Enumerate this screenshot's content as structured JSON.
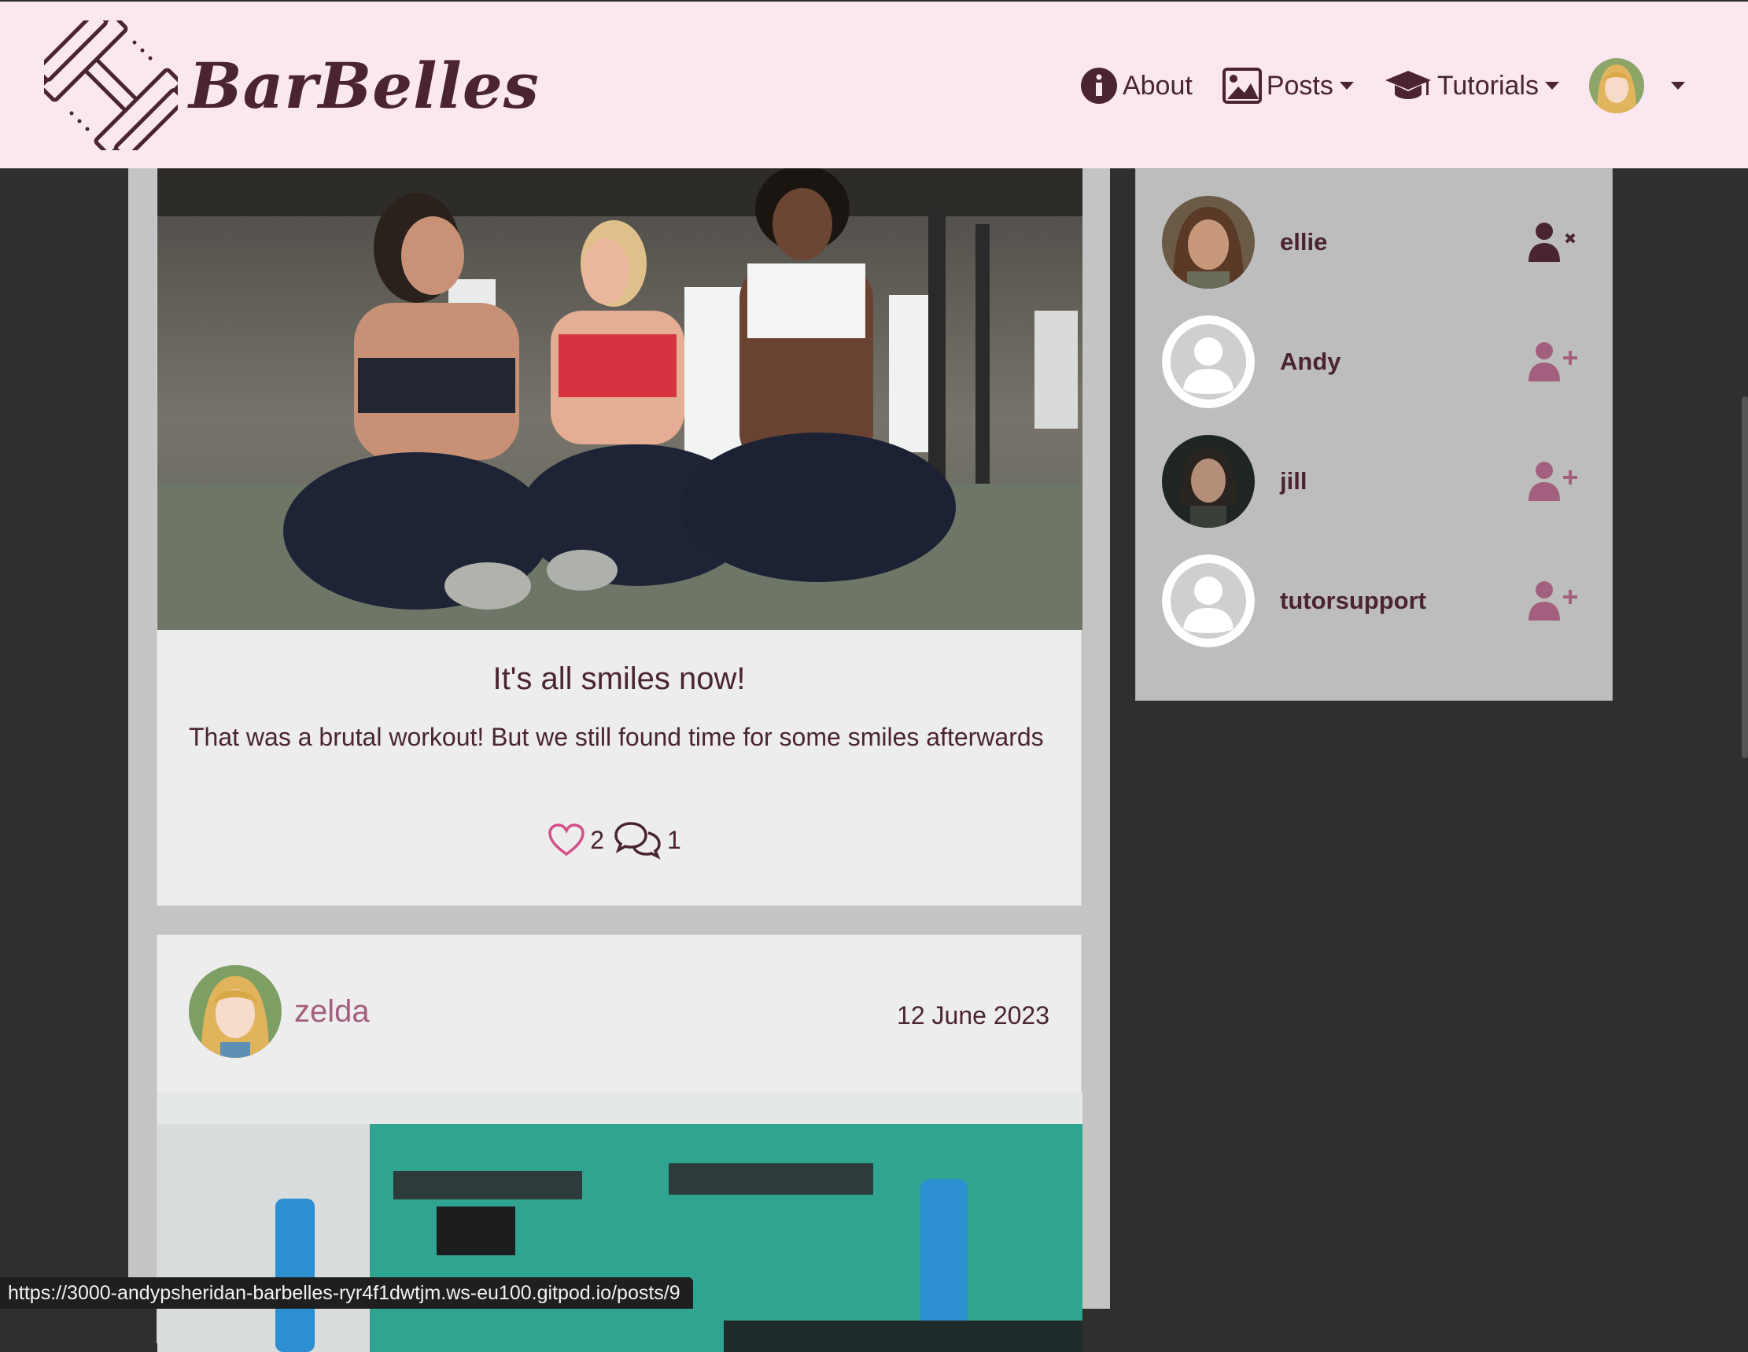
{
  "brand": {
    "name": "BarBelles",
    "icon": "dumbbell-icon"
  },
  "nav": {
    "about": "About",
    "posts": "Posts",
    "tutorials": "Tutorials"
  },
  "posts": [
    {
      "title": "It's all smiles now!",
      "body": "That was a brutal workout! But we still found time for some smiles afterwards",
      "likes": "2",
      "comments": "1"
    },
    {
      "author": "zelda",
      "date": "12 June 2023"
    }
  ],
  "profiles": [
    {
      "name": "ellie",
      "action": "unfollow"
    },
    {
      "name": "Andy",
      "action": "follow"
    },
    {
      "name": "jill",
      "action": "follow"
    },
    {
      "name": "tutorsupport",
      "action": "follow"
    }
  ],
  "status_url": "https://3000-andypsheridan-barbelles-ryr4f1dwtjm.ws-eu100.gitpod.io/posts/9",
  "colors": {
    "navbar_bg": "#fbe7ef",
    "accent": "#a3607e",
    "text": "#4a2433",
    "page_bg": "#2f2f2f"
  }
}
